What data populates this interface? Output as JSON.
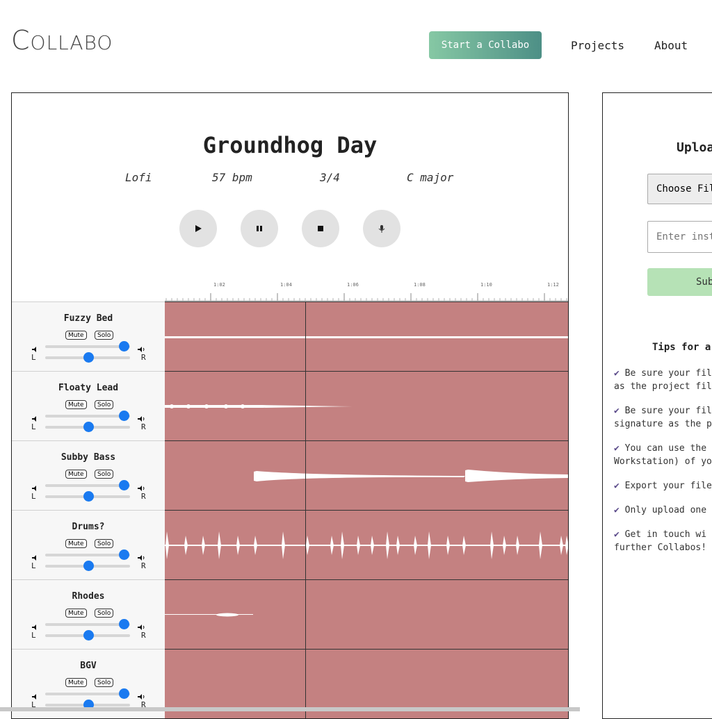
{
  "header": {
    "logo_big": "C",
    "logo_rest": "OLLABO",
    "start_label": "Start a Collabo",
    "nav": [
      {
        "label": "Projects"
      },
      {
        "label": "About"
      }
    ]
  },
  "song": {
    "title": "Groundhog Day",
    "genre": "Lofi",
    "tempo": "57 bpm",
    "time_signature": "3/4",
    "key": "C major"
  },
  "controls": [
    "play-icon",
    "pause-icon",
    "stop-icon",
    "microphone-icon"
  ],
  "ruler": {
    "labels": [
      "1:02",
      "1:04",
      "1:06",
      "1:08",
      "1:10",
      "1:12"
    ]
  },
  "mute_label": "Mute",
  "solo_label": "Solo",
  "pan_left": "L",
  "pan_right": "R",
  "tracks": [
    {
      "name": "Fuzzy Bed",
      "volume": 1.0,
      "pan": 0.5
    },
    {
      "name": "Floaty Lead",
      "volume": 1.0,
      "pan": 0.5
    },
    {
      "name": "Subby Bass",
      "volume": 1.0,
      "pan": 0.5
    },
    {
      "name": "Drums?",
      "volume": 1.0,
      "pan": 0.5
    },
    {
      "name": "Rhodes",
      "volume": 1.0,
      "pan": 0.5
    },
    {
      "name": "BGV",
      "volume": 1.0,
      "pan": 0.5
    }
  ],
  "colors": {
    "lane": "#c48181",
    "accent": "#1a7af0",
    "submit": "#b6e2b6",
    "check": "#5b4b8a"
  },
  "upload": {
    "title": "Uploa",
    "choose_file": "Choose Fil",
    "instrument_placeholder": "Enter inst",
    "submit": "Sub",
    "tips_title": "Tips for a",
    "tips": [
      {
        "l1": "Be sure your fil",
        "l2": "as the project file"
      },
      {
        "l1": "Be sure your fil",
        "l2": "signature as the p"
      },
      {
        "l1": "You can use the",
        "l2": "Workstation) of yo"
      },
      {
        "l1": "Export your file",
        "l2": ""
      },
      {
        "l1": "Only upload one",
        "l2": ""
      },
      {
        "l1": "Get in touch wi",
        "l2": "further Collabos!"
      }
    ]
  }
}
